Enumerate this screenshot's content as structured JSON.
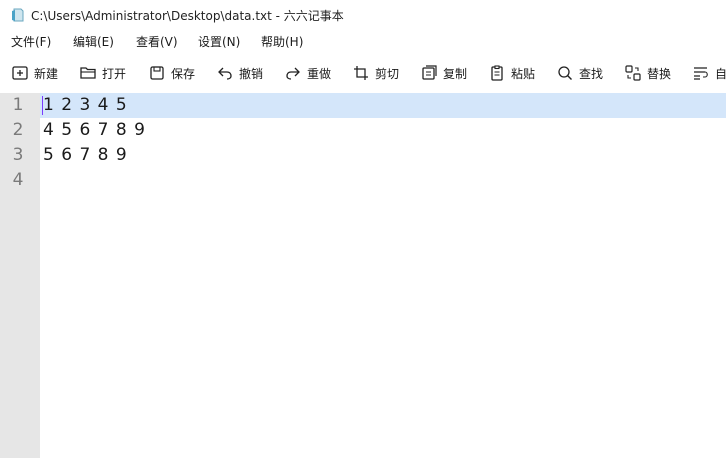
{
  "window": {
    "title": "C:\\Users\\Administrator\\Desktop\\data.txt - 六六记事本"
  },
  "menu": [
    {
      "label": "文件(F)"
    },
    {
      "label": "编辑(E)"
    },
    {
      "label": "查看(V)"
    },
    {
      "label": "设置(N)"
    },
    {
      "label": "帮助(H)"
    }
  ],
  "toolbar": [
    {
      "label": "新建",
      "icon": "new-file-icon"
    },
    {
      "label": "打开",
      "icon": "folder-open-icon"
    },
    {
      "label": "保存",
      "icon": "save-icon"
    },
    {
      "label": "撤销",
      "icon": "undo-icon"
    },
    {
      "label": "重做",
      "icon": "redo-icon"
    },
    {
      "label": "剪切",
      "icon": "crop-icon"
    },
    {
      "label": "复制",
      "icon": "copy-icon"
    },
    {
      "label": "粘贴",
      "icon": "clipboard-icon"
    },
    {
      "label": "查找",
      "icon": "search-icon"
    },
    {
      "label": "替换",
      "icon": "replace-icon"
    },
    {
      "label": "自",
      "icon": "wrap-icon"
    }
  ],
  "editor": {
    "line_numbers": [
      "1",
      "2",
      "3",
      "4"
    ],
    "lines": [
      "1 2 3 4 5",
      "4 5 6 7 8 9",
      "5 6 7 8 9",
      ""
    ],
    "current_line": 1
  },
  "colors": {
    "gutter": "#e6e6e6",
    "current_line": "#d4e6fa",
    "caret": "#7a3cff"
  }
}
